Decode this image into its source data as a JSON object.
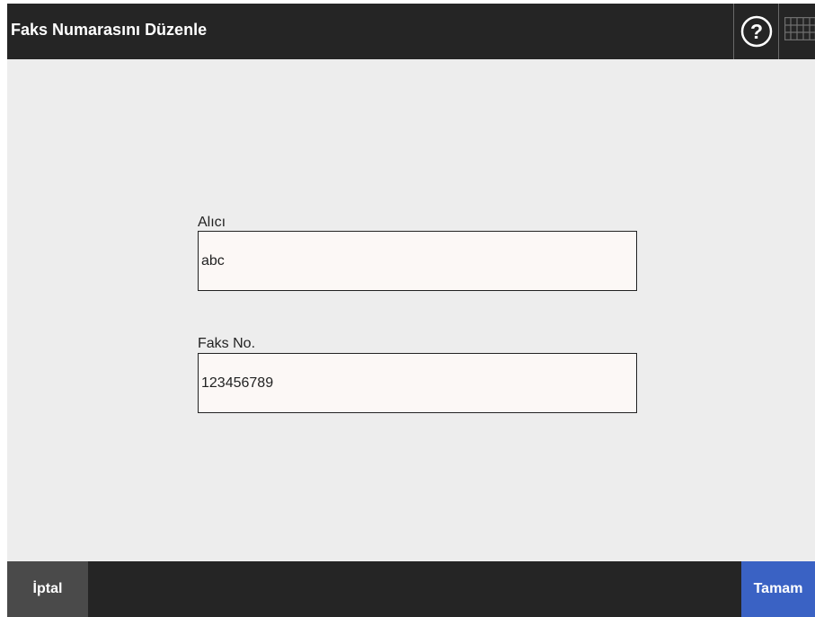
{
  "header": {
    "title": "Faks Numarasını Düzenle",
    "help_icon": "question-mark-circle-icon",
    "keyboard_icon": "keyboard-icon"
  },
  "form": {
    "recipient": {
      "label": "Alıcı",
      "value": "abc"
    },
    "fax_number": {
      "label": "Faks No.",
      "value": "123456789"
    }
  },
  "footer": {
    "cancel_label": "İptal",
    "ok_label": "Tamam"
  },
  "colors": {
    "titlebar": "#252525",
    "content_background": "#ededed",
    "field_background": "#fcf8f6",
    "cancel_button": "#4a4a4a",
    "ok_button": "#3a62c4"
  }
}
